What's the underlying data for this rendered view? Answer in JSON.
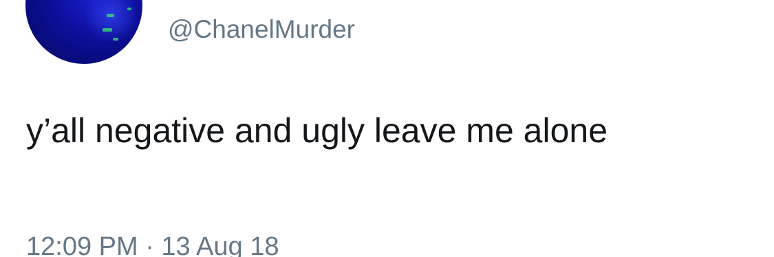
{
  "tweet": {
    "avatar_icon": "profile-photo-blue",
    "handle": "@ChanelMurder",
    "text": "y’all negative and ugly leave me alone",
    "timestamp": "12:09 PM · 13 Aug 18"
  },
  "colors": {
    "text_primary": "#14171a",
    "text_secondary": "#657786",
    "avatar_blue": "#0c0f9a"
  }
}
